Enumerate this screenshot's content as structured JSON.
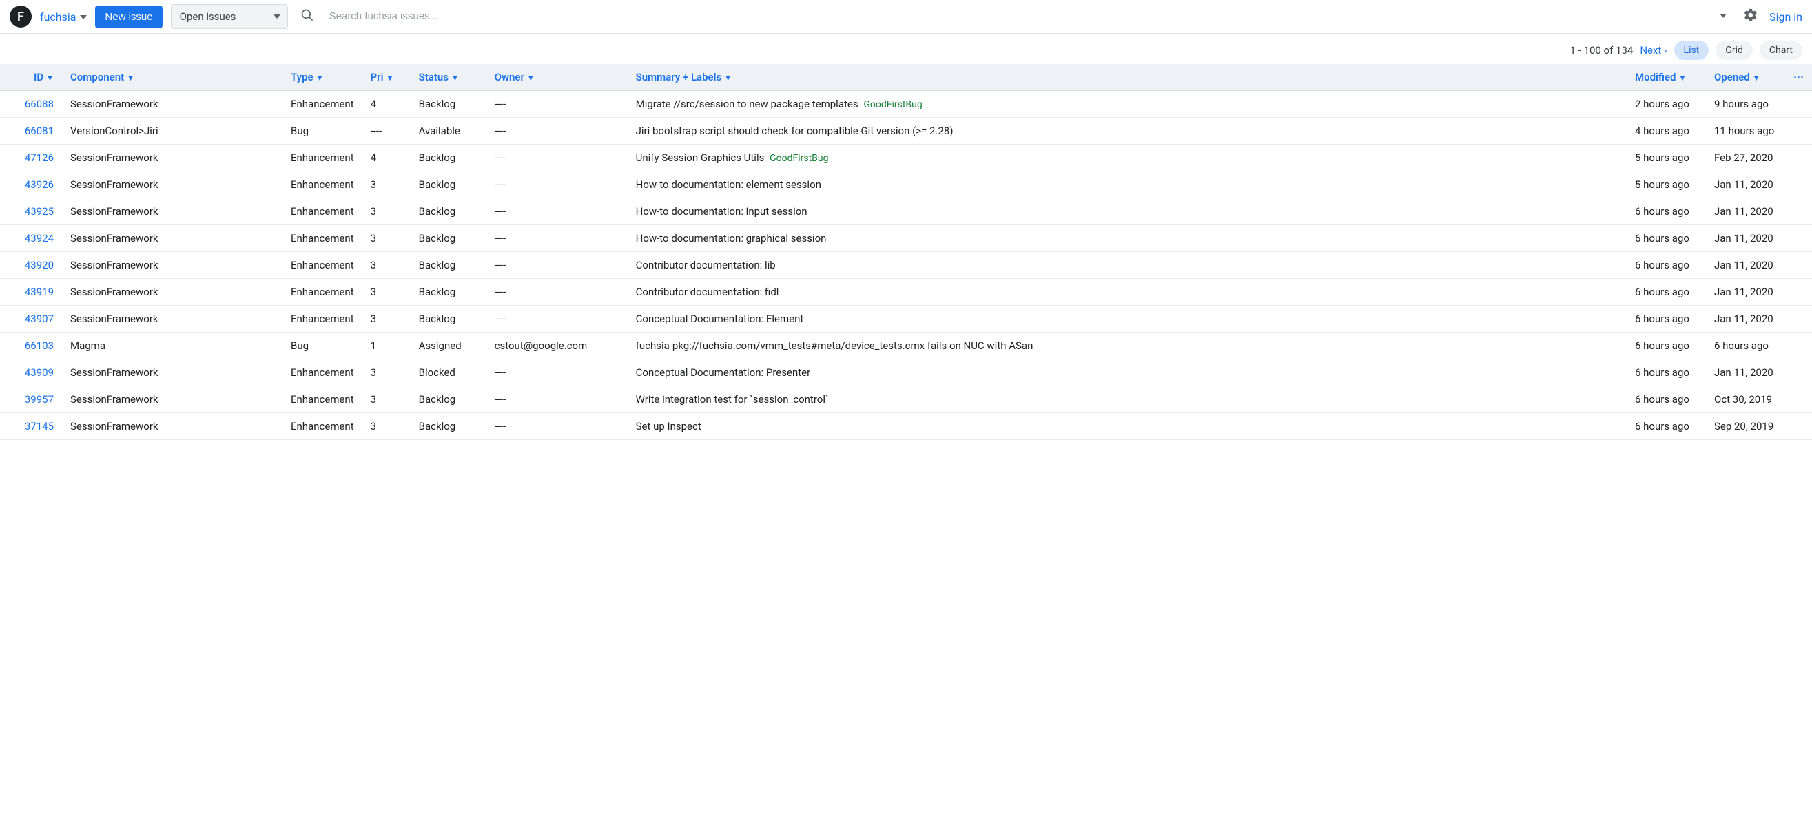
{
  "header": {
    "logo_letter": "F",
    "project_name": "fuchsia",
    "new_issue_label": "New issue",
    "filter_label": "Open issues",
    "search_placeholder": "Search fuchsia issues...",
    "signin_label": "Sign in"
  },
  "toolbar": {
    "pager_text": "1 - 100 of 134",
    "next_label": "Next ›",
    "views": {
      "list": "List",
      "grid": "Grid",
      "chart": "Chart"
    }
  },
  "columns": {
    "id": "ID",
    "component": "Component",
    "type": "Type",
    "pri": "Pri",
    "status": "Status",
    "owner": "Owner",
    "summary": "Summary + Labels",
    "modified": "Modified",
    "opened": "Opened"
  },
  "rows": [
    {
      "id": "66088",
      "component": "SessionFramework",
      "type": "Enhancement",
      "pri": "4",
      "status": "Backlog",
      "owner": "----",
      "summary": "Migrate //src/session to new package templates",
      "labels": [
        "GoodFirstBug"
      ],
      "modified": "2 hours ago",
      "opened": "9 hours ago"
    },
    {
      "id": "66081",
      "component": "VersionControl>Jiri",
      "type": "Bug",
      "pri": "----",
      "status": "Available",
      "owner": "----",
      "summary": "Jiri bootstrap script should check for compatible Git version (>= 2.28)",
      "labels": [],
      "modified": "4 hours ago",
      "opened": "11 hours ago"
    },
    {
      "id": "47126",
      "component": "SessionFramework",
      "type": "Enhancement",
      "pri": "4",
      "status": "Backlog",
      "owner": "----",
      "summary": "Unify Session Graphics Utils",
      "labels": [
        "GoodFirstBug"
      ],
      "modified": "5 hours ago",
      "opened": "Feb 27, 2020"
    },
    {
      "id": "43926",
      "component": "SessionFramework",
      "type": "Enhancement",
      "pri": "3",
      "status": "Backlog",
      "owner": "----",
      "summary": "How-to documentation: element session",
      "labels": [],
      "modified": "5 hours ago",
      "opened": "Jan 11, 2020"
    },
    {
      "id": "43925",
      "component": "SessionFramework",
      "type": "Enhancement",
      "pri": "3",
      "status": "Backlog",
      "owner": "----",
      "summary": "How-to documentation: input session",
      "labels": [],
      "modified": "6 hours ago",
      "opened": "Jan 11, 2020"
    },
    {
      "id": "43924",
      "component": "SessionFramework",
      "type": "Enhancement",
      "pri": "3",
      "status": "Backlog",
      "owner": "----",
      "summary": "How-to documentation: graphical session",
      "labels": [],
      "modified": "6 hours ago",
      "opened": "Jan 11, 2020"
    },
    {
      "id": "43920",
      "component": "SessionFramework",
      "type": "Enhancement",
      "pri": "3",
      "status": "Backlog",
      "owner": "----",
      "summary": "Contributor documentation: lib",
      "labels": [],
      "modified": "6 hours ago",
      "opened": "Jan 11, 2020"
    },
    {
      "id": "43919",
      "component": "SessionFramework",
      "type": "Enhancement",
      "pri": "3",
      "status": "Backlog",
      "owner": "----",
      "summary": "Contributor documentation: fidl",
      "labels": [],
      "modified": "6 hours ago",
      "opened": "Jan 11, 2020"
    },
    {
      "id": "43907",
      "component": "SessionFramework",
      "type": "Enhancement",
      "pri": "3",
      "status": "Backlog",
      "owner": "----",
      "summary": "Conceptual Documentation: Element",
      "labels": [],
      "modified": "6 hours ago",
      "opened": "Jan 11, 2020"
    },
    {
      "id": "66103",
      "component": "Magma",
      "type": "Bug",
      "pri": "1",
      "status": "Assigned",
      "owner": "cstout@google.com",
      "summary": "fuchsia-pkg://fuchsia.com/vmm_tests#meta/device_tests.cmx fails on NUC with ASan",
      "labels": [],
      "modified": "6 hours ago",
      "opened": "6 hours ago"
    },
    {
      "id": "43909",
      "component": "SessionFramework",
      "type": "Enhancement",
      "pri": "3",
      "status": "Blocked",
      "owner": "----",
      "summary": "Conceptual Documentation: Presenter",
      "labels": [],
      "modified": "6 hours ago",
      "opened": "Jan 11, 2020"
    },
    {
      "id": "39957",
      "component": "SessionFramework",
      "type": "Enhancement",
      "pri": "3",
      "status": "Backlog",
      "owner": "----",
      "summary": "Write integration test for `session_control`",
      "labels": [],
      "modified": "6 hours ago",
      "opened": "Oct 30, 2019"
    },
    {
      "id": "37145",
      "component": "SessionFramework",
      "type": "Enhancement",
      "pri": "3",
      "status": "Backlog",
      "owner": "----",
      "summary": "Set up Inspect",
      "labels": [],
      "modified": "6 hours ago",
      "opened": "Sep 20, 2019"
    }
  ]
}
